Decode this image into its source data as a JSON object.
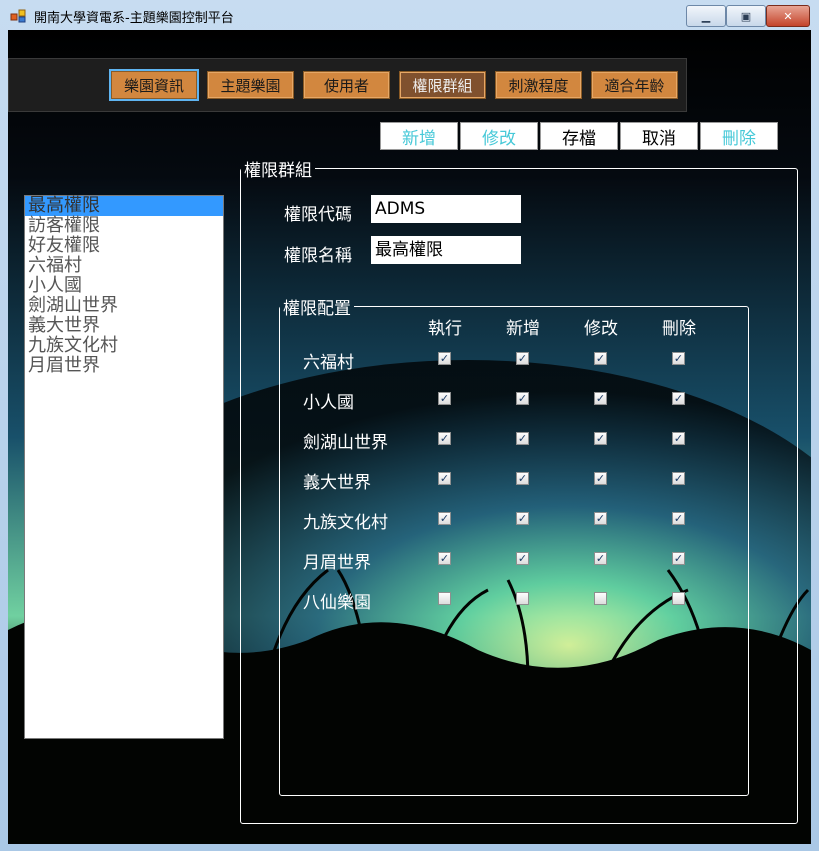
{
  "window": {
    "title": "開南大學資電系-主題樂園控制平台"
  },
  "menu": [
    {
      "label": "樂園資訊",
      "active": true
    },
    {
      "label": "主題樂園"
    },
    {
      "label": "使用者"
    },
    {
      "label": "權限群組",
      "dark": true
    },
    {
      "label": "刺激程度"
    },
    {
      "label": "適合年齡"
    }
  ],
  "actions": [
    {
      "label": "新增",
      "style": "cyan"
    },
    {
      "label": "修改",
      "style": "cyan"
    },
    {
      "label": "存檔",
      "style": "black"
    },
    {
      "label": "取消",
      "style": "black"
    },
    {
      "label": "刪除",
      "style": "cyan"
    }
  ],
  "permission_list": {
    "items": [
      "最高權限",
      "訪客權限",
      "好友權限",
      "六福村",
      "小人國",
      "劍湖山世界",
      "義大世界",
      "九族文化村",
      "月眉世界"
    ],
    "selected_index": 0
  },
  "group_panel": {
    "legend": "權限群組",
    "code_label": "權限代碼",
    "code_value": "ADMS",
    "name_label": "權限名稱",
    "name_value": "最高權限"
  },
  "config_panel": {
    "legend": "權限配置",
    "columns": [
      "執行",
      "新增",
      "修改",
      "刪除"
    ],
    "rows": [
      {
        "name": "六福村",
        "checks": [
          true,
          true,
          true,
          true
        ]
      },
      {
        "name": "小人國",
        "checks": [
          true,
          true,
          true,
          true
        ]
      },
      {
        "name": "劍湖山世界",
        "checks": [
          true,
          true,
          true,
          true
        ]
      },
      {
        "name": "義大世界",
        "checks": [
          true,
          true,
          true,
          true
        ]
      },
      {
        "name": "九族文化村",
        "checks": [
          true,
          true,
          true,
          true
        ]
      },
      {
        "name": "月眉世界",
        "checks": [
          true,
          true,
          true,
          true
        ]
      },
      {
        "name": "八仙樂園",
        "checks": [
          false,
          false,
          false,
          false
        ]
      }
    ]
  },
  "colors": {
    "accent_cyan": "#47c9d8",
    "menu_orange": "#d2873f",
    "selection": "#3399ff"
  }
}
